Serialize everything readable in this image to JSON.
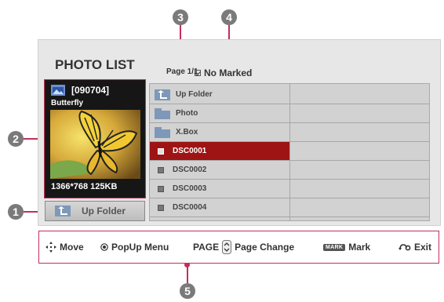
{
  "callouts": {
    "c1": "1",
    "c2": "2",
    "c3": "3",
    "c4": "4",
    "c5": "5"
  },
  "header": {
    "title": "PHOTO LIST",
    "page": "Page 1/1",
    "marked": "No Marked"
  },
  "preview": {
    "folder_date": "[090704]",
    "name": "Butterfly",
    "size": "1366*768  125KB"
  },
  "up_button": {
    "label": "Up Folder"
  },
  "list": {
    "items": [
      {
        "label": "Up Folder",
        "type": "up-folder"
      },
      {
        "label": "Photo",
        "type": "folder"
      },
      {
        "label": "X.Box",
        "type": "folder"
      },
      {
        "label": "DSC0001",
        "type": "file",
        "selected": true
      },
      {
        "label": "DSC0002",
        "type": "file"
      },
      {
        "label": "DSC0003",
        "type": "file"
      },
      {
        "label": "DSC0004",
        "type": "file"
      }
    ]
  },
  "bottom_bar": {
    "move": "Move",
    "popup": "PopUp  Menu",
    "page_key": "PAGE",
    "page_change": "Page  Change",
    "mark_badge": "MARK",
    "mark": "Mark",
    "exit": "Exit"
  },
  "colors": {
    "accent": "#c0305a",
    "selected_row": "#9e1414",
    "folder_icon": "#7d98b8"
  }
}
